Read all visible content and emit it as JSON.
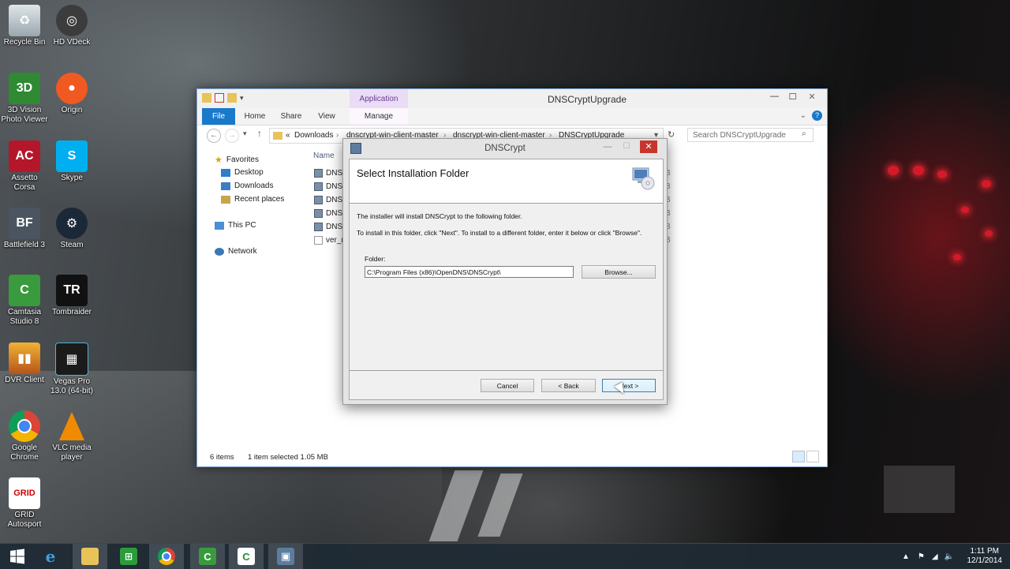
{
  "desktop": {
    "icons": [
      {
        "label": "Recycle Bin",
        "icon": "recycle-bin-icon"
      },
      {
        "label": "HD VDeck",
        "icon": "hd-vdeck-icon"
      },
      {
        "label": "3D Vision Photo Viewer",
        "icon": "3d-vision-icon"
      },
      {
        "label": "Origin",
        "icon": "origin-icon"
      },
      {
        "label": "Assetto Corsa",
        "icon": "assetto-corsa-icon"
      },
      {
        "label": "Skype",
        "icon": "skype-icon"
      },
      {
        "label": "Battlefield 3",
        "icon": "battlefield-icon"
      },
      {
        "label": "Steam",
        "icon": "steam-icon"
      },
      {
        "label": "Camtasia Studio 8",
        "icon": "camtasia-icon"
      },
      {
        "label": "Tombraider",
        "icon": "tombraider-icon"
      },
      {
        "label": "DVR Client",
        "icon": "dvr-client-icon"
      },
      {
        "label": "Vegas Pro 13.0 (64-bit)",
        "icon": "vegas-pro-icon"
      },
      {
        "label": "Google Chrome",
        "icon": "chrome-icon"
      },
      {
        "label": "VLC media player",
        "icon": "vlc-icon"
      },
      {
        "label": "GRID Autosport",
        "icon": "grid-autosport-icon"
      }
    ]
  },
  "explorer": {
    "title": "DNSCryptUpgrade",
    "contextual_tab": "Application Tools",
    "ribbon_tabs": [
      "File",
      "Home",
      "Share",
      "View",
      "Manage"
    ],
    "breadcrumb": [
      "«",
      "Downloads",
      "dnscrypt-win-client-master",
      "dnscrypt-win-client-master",
      "DNSCryptUpgrade"
    ],
    "search_placeholder": "Search DNSCryptUpgrade",
    "nav": {
      "favorites": "Favorites",
      "desktop": "Desktop",
      "downloads": "Downloads",
      "recent": "Recent places",
      "this_pc": "This PC",
      "network": "Network"
    },
    "column_name": "Name",
    "files": [
      "DNSC",
      "DNSC",
      "DNSC",
      "DNSC",
      "DNSC",
      "ver_n"
    ],
    "right_fragments": [
      "B",
      "B",
      "B",
      "B",
      "B",
      "B"
    ],
    "status": {
      "items": "6 items",
      "selected": "1 item selected  1.05 MB"
    }
  },
  "dialog": {
    "title": "DNSCrypt",
    "heading": "Select Installation Folder",
    "line1": "The installer will install DNSCrypt to the following folder.",
    "line2": "To install in this folder, click \"Next\". To install to a different folder, enter it below or click \"Browse\".",
    "folder_label": "Folder:",
    "folder_value": "C:\\Program Files (x86)\\OpenDNS\\DNSCrypt\\",
    "browse": "Browse...",
    "cancel": "Cancel",
    "back": "< Back",
    "next": "Next >"
  },
  "taskbar": {
    "apps": [
      "windows-start-icon",
      "internet-explorer-icon",
      "file-explorer-icon",
      "store-icon",
      "chrome-icon",
      "camtasia-recorder-icon",
      "camtasia-icon",
      "installer-icon"
    ],
    "time": "1:11 PM",
    "date": "12/1/2014"
  },
  "colors": {
    "accent": "#1979ca",
    "close_red": "#c7362c",
    "app_tools_purple": "#eadcf5"
  }
}
